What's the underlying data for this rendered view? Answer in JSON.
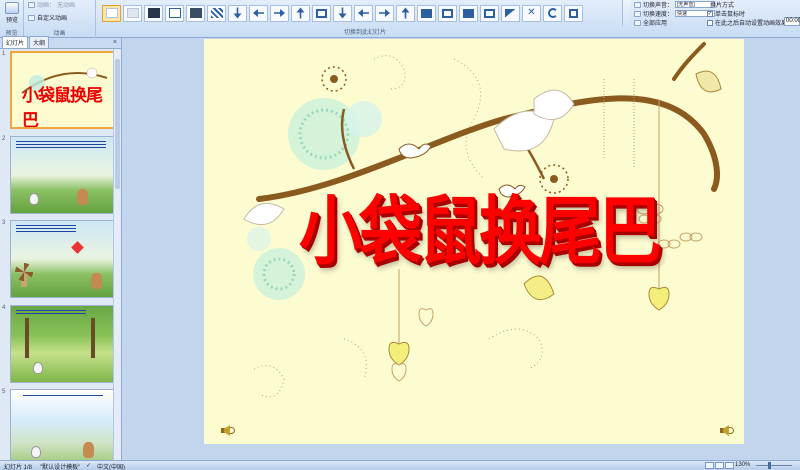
{
  "ribbon": {
    "preview_group": {
      "button": "预览",
      "label": "预览"
    },
    "animation_group": {
      "row1": "动画：",
      "row1_value": "无动画",
      "row2": "自定义动画",
      "label": "动画"
    },
    "transition_group_label": "切换到此幻灯片",
    "transition_options": {
      "sound_label": "切换声音：",
      "sound_value": "[无声音]",
      "speed_label": "切换速度：",
      "speed_value": "快速",
      "apply_all": "全部应用"
    },
    "advance": {
      "heading": "换片方式",
      "on_click": "单击鼠标时",
      "on_click_checked": true,
      "after_time": "在此之后自动设置动画效果：",
      "after_time_checked": false,
      "time_value": "00:00"
    }
  },
  "left_pane": {
    "tabs": [
      "幻灯片",
      "大纲"
    ],
    "close": "×",
    "slides": [
      {
        "num": "1",
        "title": "小袋鼠换尾巴"
      },
      {
        "num": "2"
      },
      {
        "num": "3"
      },
      {
        "num": "4"
      },
      {
        "num": "5"
      }
    ]
  },
  "slide": {
    "title": "小袋鼠换尾巴"
  },
  "statusbar": {
    "slide_info": "幻灯片 1/8",
    "theme": "\"默认设计模板\"",
    "language": "中文(中国)",
    "zoom": "130%"
  },
  "colors": {
    "title_red": "#ff0000",
    "slide_bg": "#fdfbd0",
    "selection_orange": "#f0a540"
  }
}
